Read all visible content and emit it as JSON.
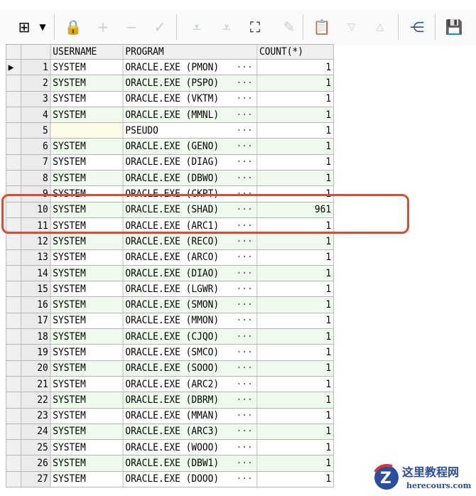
{
  "toolbar": {
    "icons": [
      "grid-layout-icon",
      "dropdown-icon",
      "lock-icon",
      "add-record-icon",
      "delete-record-icon",
      "post-icon",
      "filter-down-icon",
      "filter-clear-icon",
      "find-icon",
      "clear-icon",
      "export-icon",
      "next-icon",
      "previous-icon",
      "query-plan-icon",
      "save-icon"
    ]
  },
  "table": {
    "headers": [
      "USERNAME",
      "PROGRAM",
      "COUNT(*)"
    ],
    "rows": [
      {
        "n": "1",
        "user": "SYSTEM",
        "prog": "ORACLE.EXE (PMON)",
        "count": "1"
      },
      {
        "n": "2",
        "user": "SYSTEM",
        "prog": "ORACLE.EXE (PSPO)",
        "count": "1"
      },
      {
        "n": "3",
        "user": "SYSTEM",
        "prog": "ORACLE.EXE (VKTM)",
        "count": "1"
      },
      {
        "n": "4",
        "user": "SYSTEM",
        "prog": "ORACLE.EXE (MMNL)",
        "count": "1"
      },
      {
        "n": "5",
        "user": "",
        "prog": "PSEUDO",
        "count": "1"
      },
      {
        "n": "6",
        "user": "SYSTEM",
        "prog": "ORACLE.EXE (GENO)",
        "count": "1"
      },
      {
        "n": "7",
        "user": "SYSTEM",
        "prog": "ORACLE.EXE (DIAG)",
        "count": "1"
      },
      {
        "n": "8",
        "user": "SYSTEM",
        "prog": "ORACLE.EXE (DBWO)",
        "count": "1"
      },
      {
        "n": "9",
        "user": "SYSTEM",
        "prog": "ORACLE.EXE (CKPT)",
        "count": "1"
      },
      {
        "n": "10",
        "user": "SYSTEM",
        "prog": "ORACLE.EXE (SHAD)",
        "count": "961"
      },
      {
        "n": "11",
        "user": "SYSTEM",
        "prog": "ORACLE.EXE (ARC1)",
        "count": "1"
      },
      {
        "n": "12",
        "user": "SYSTEM",
        "prog": "ORACLE.EXE (RECO)",
        "count": "1"
      },
      {
        "n": "13",
        "user": "SYSTEM",
        "prog": "ORACLE.EXE (ARCO)",
        "count": "1"
      },
      {
        "n": "14",
        "user": "SYSTEM",
        "prog": "ORACLE.EXE (DIAO)",
        "count": "1"
      },
      {
        "n": "15",
        "user": "SYSTEM",
        "prog": "ORACLE.EXE (LGWR)",
        "count": "1"
      },
      {
        "n": "16",
        "user": "SYSTEM",
        "prog": "ORACLE.EXE (SMON)",
        "count": "1"
      },
      {
        "n": "17",
        "user": "SYSTEM",
        "prog": "ORACLE.EXE (MMON)",
        "count": "1"
      },
      {
        "n": "18",
        "user": "SYSTEM",
        "prog": "ORACLE.EXE (CJQO)",
        "count": "1"
      },
      {
        "n": "19",
        "user": "SYSTEM",
        "prog": "ORACLE.EXE (SMCO)",
        "count": "1"
      },
      {
        "n": "20",
        "user": "SYSTEM",
        "prog": "ORACLE.EXE (SOOO)",
        "count": "1"
      },
      {
        "n": "21",
        "user": "SYSTEM",
        "prog": "ORACLE.EXE (ARC2)",
        "count": "1"
      },
      {
        "n": "22",
        "user": "SYSTEM",
        "prog": "ORACLE.EXE (DBRM)",
        "count": "1"
      },
      {
        "n": "23",
        "user": "SYSTEM",
        "prog": "ORACLE.EXE (MMAN)",
        "count": "1"
      },
      {
        "n": "24",
        "user": "SYSTEM",
        "prog": "ORACLE.EXE (ARC3)",
        "count": "1"
      },
      {
        "n": "25",
        "user": "SYSTEM",
        "prog": "ORACLE.EXE (WOOO)",
        "count": "1"
      },
      {
        "n": "26",
        "user": "SYSTEM",
        "prog": "ORACLE.EXE (DBW1)",
        "count": "1"
      },
      {
        "n": "27",
        "user": "SYSTEM",
        "prog": "ORACLE.EXE (DOOO)",
        "count": "1"
      }
    ],
    "ellipsis": "···",
    "current_marker": "▶"
  },
  "watermark": {
    "title": "这里教程网",
    "site": "herecours.com"
  },
  "colors": {
    "highlight": "#e04a2f",
    "even_row": "#eefaec"
  }
}
